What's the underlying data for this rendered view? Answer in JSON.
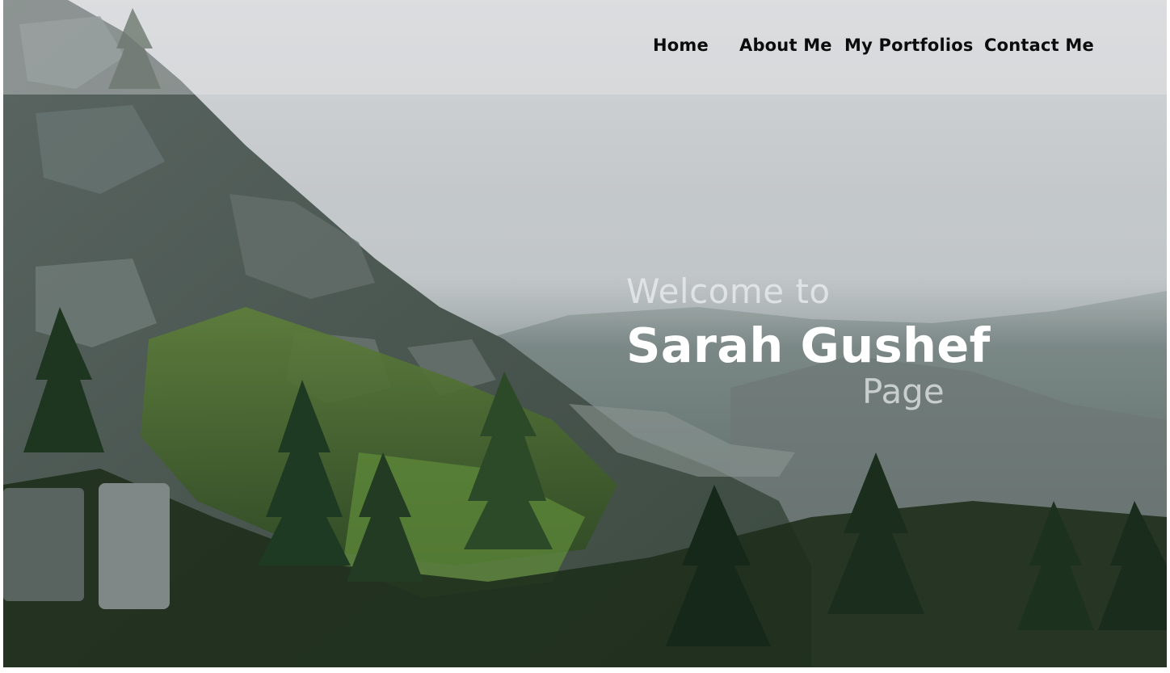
{
  "nav": {
    "items": [
      {
        "label": "Home"
      },
      {
        "label": "About Me"
      },
      {
        "label": "My Portfolios"
      },
      {
        "label": "Contact Me"
      }
    ]
  },
  "hero": {
    "welcome": "Welcome to",
    "name": "Sarah Gushef",
    "page": "Page",
    "background_image": "foggy mountain slope with pine forest"
  },
  "colors": {
    "nav_text": "#0c0c0c",
    "hero_name": "#ffffff",
    "hero_subtext": "#e8eaeb"
  }
}
